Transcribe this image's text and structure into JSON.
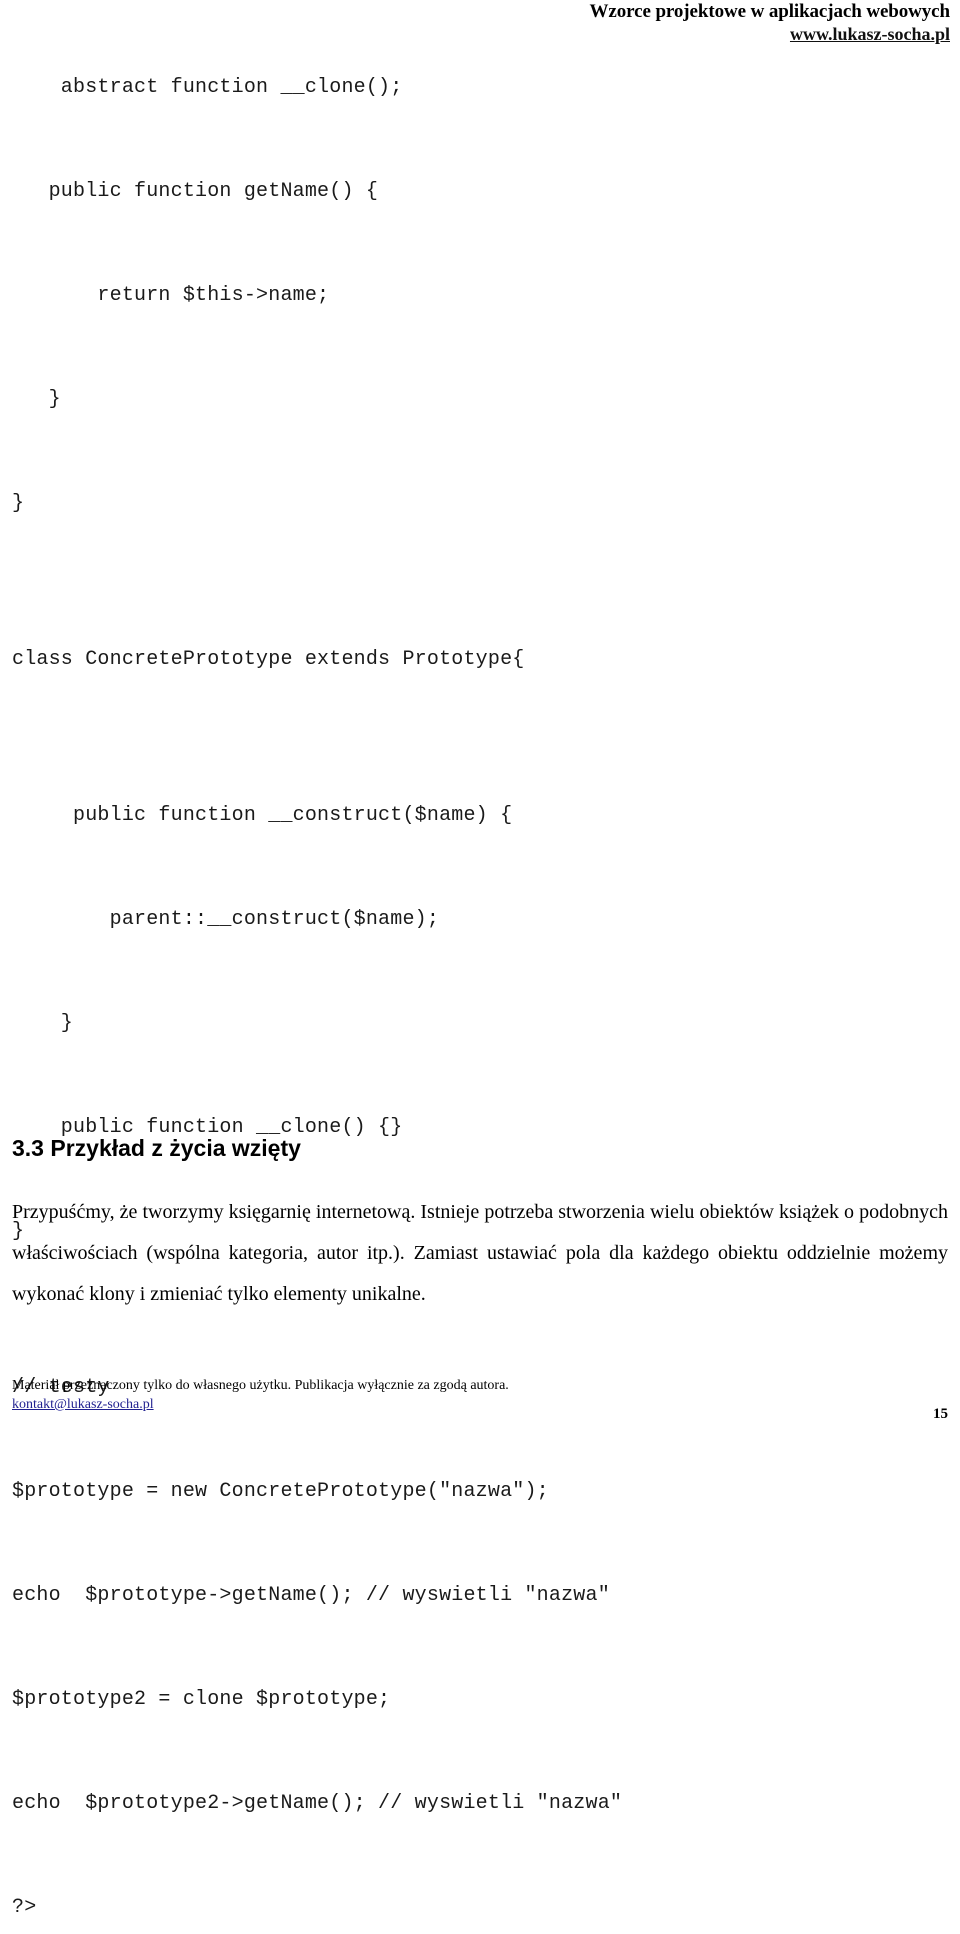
{
  "header": {
    "title": "Wzorce projektowe w aplikacjach webowych",
    "url": "www.lukasz-socha.pl"
  },
  "code": {
    "language": "php",
    "lines": [
      "    abstract function __clone();",
      "",
      "   public function getName() {",
      "",
      "       return $this->name;",
      "",
      "   }",
      "",
      "}",
      "",
      "",
      "class ConcretePrototype extends Prototype{",
      "",
      "",
      "     public function __construct($name) {",
      "",
      "        parent::__construct($name);",
      "",
      "    }",
      "",
      "    public function __clone() {}",
      "",
      "}",
      "",
      "",
      "// testy",
      "",
      "$prototype = new ConcretePrototype(\"nazwa\");",
      "",
      "echo  $prototype->getName(); // wyswietli \"nazwa\"",
      "",
      "$prototype2 = clone $prototype;",
      "",
      "echo  $prototype2->getName(); // wyswietli \"nazwa\"",
      "",
      "?>"
    ]
  },
  "section": {
    "heading": "3.3 Przykład z życia wzięty",
    "paragraph": "Przypuśćmy, że tworzymy księgarnię internetową. Istnieje potrzeba stworzenia wielu obiektów książek o podobnych właściwościach (wspólna kategoria, autor itp.). Zamiast ustawiać pola dla każdego obiektu oddzielnie możemy wykonać klony i zmieniać tylko elementy unikalne."
  },
  "footer": {
    "notice": "Materiał przeznaczony tylko do własnego użytku. Publikacja wyłącznie za zgodą autora.",
    "email": "kontakt@lukasz-socha.pl",
    "page_number": "15"
  },
  "colors": {
    "text": "#000000",
    "code_text": "#1a1a1a",
    "link": "#1f1f8f",
    "background": "#ffffff"
  }
}
